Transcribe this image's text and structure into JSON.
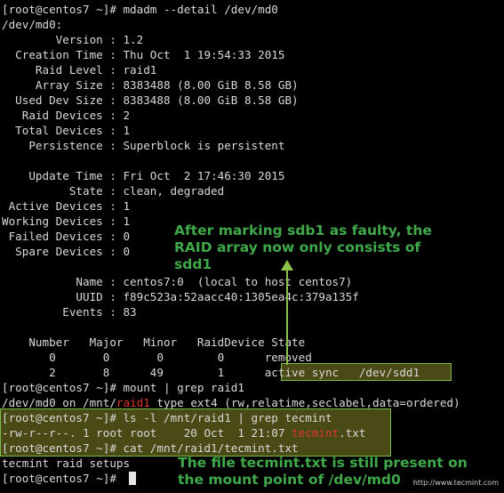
{
  "terminal": {
    "lines": [
      "[root@centos7 ~]# mdadm --detail /dev/md0",
      "/dev/md0:",
      "        Version : 1.2",
      "  Creation Time : Thu Oct  1 19:54:33 2015",
      "     Raid Level : raid1",
      "     Array Size : 8383488 (8.00 GiB 8.58 GB)",
      "  Used Dev Size : 8383488 (8.00 GiB 8.58 GB)",
      "   Raid Devices : 2",
      "  Total Devices : 1",
      "    Persistence : Superblock is persistent",
      "",
      "    Update Time : Fri Oct  2 17:46:30 2015",
      "          State : clean, degraded",
      " Active Devices : 1",
      "Working Devices : 1",
      " Failed Devices : 0",
      "  Spare Devices : 0",
      "",
      "           Name : centos7:0  (local to host centos7)",
      "           UUID : f89c523a:52aacc40:1305ea4c:379a135f",
      "         Events : 83",
      "",
      "",
      "    Number   Major   Minor   RaidDevice State",
      "       0       0       0        0      removed",
      "       2       8      49        1      active sync   /dev/sdd1",
      "[root@centos7 ~]# mount | grep raid1",
      "/dev/md0 on /mnt/raid1 type ext4 (rw,relatime,seclabel,data=ordered)",
      "[root@centos7 ~]# ls -l /mnt/raid1 | grep tecmint",
      "-rw-r--r--. 1 root root    20 Oct  1 21:07 tecmint.txt",
      "[root@centos7 ~]# cat /mnt/raid1/tecmint.txt",
      "tecmint raid setups",
      "[root@centos7 ~]# "
    ],
    "mount_line": {
      "before": "/dev/md0 on /mnt/",
      "highlight": "raid1",
      "after": " type ext4 (rw,relatime,seclabel,data=ordered)"
    },
    "ls_line": {
      "before": "-rw-r--r--. 1 root root    20 Oct  1 21:07 ",
      "highlight": "tecmint",
      "after": ".txt"
    }
  },
  "annotations": {
    "faulty_note": "After marking sdb1 as faulty, the\nRAID array now only consists of\nsdd1",
    "file_note": "The file tecmint.txt is still present on\nthe mount point of /dev/md0"
  },
  "watermark": "http://www.tecmint.com",
  "colors": {
    "background": "#000000",
    "text": "#d9d9d9",
    "grep_match": "#e0362c",
    "annotation": "#3fa94a",
    "highlight_border": "#7bb84a"
  }
}
